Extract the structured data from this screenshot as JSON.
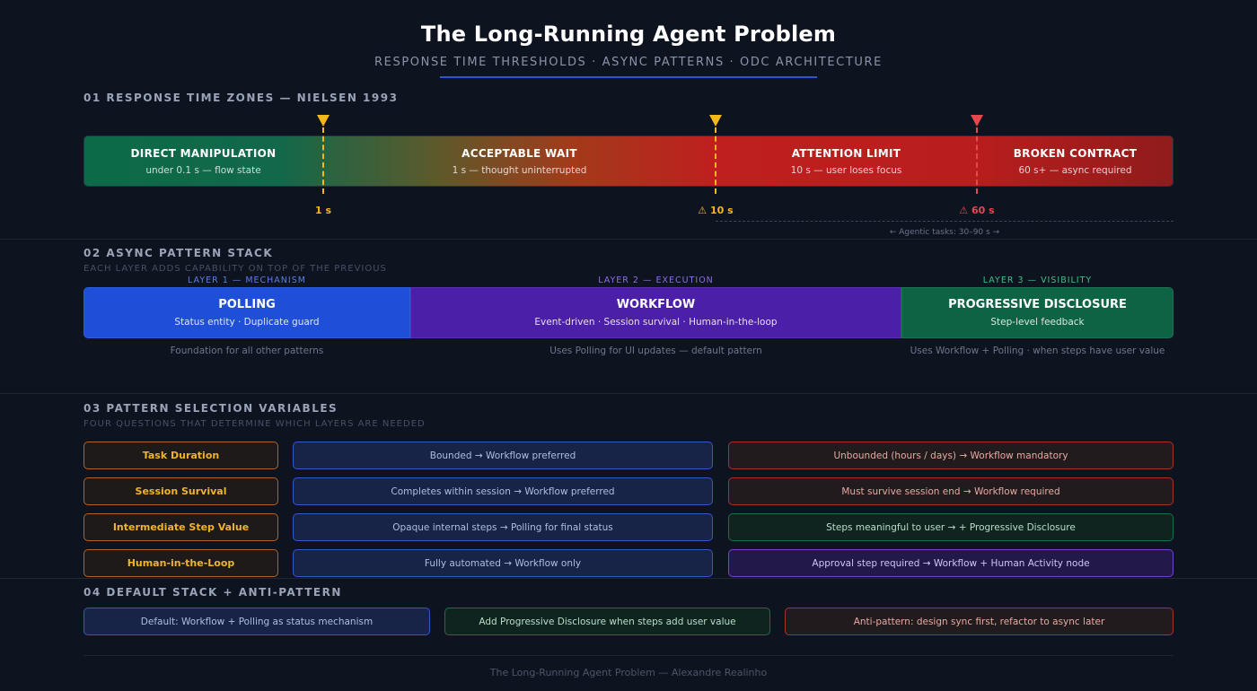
{
  "header": {
    "title": "The Long-Running Agent Problem",
    "subtitle": "RESPONSE TIME THRESHOLDS · ASYNC PATTERNS · ODC ARCHITECTURE"
  },
  "section1": {
    "title": "01 RESPONSE TIME ZONES — NIELSEN 1993",
    "zones": [
      {
        "title": "DIRECT MANIPULATION",
        "sub": "under 0.1 s — flow state"
      },
      {
        "title": "ACCEPTABLE WAIT",
        "sub": "1 s — thought uninterrupted"
      },
      {
        "title": "ATTENTION LIMIT",
        "sub": "10 s — user loses focus"
      },
      {
        "title": "BROKEN CONTRACT",
        "sub": "60 s+ — async required"
      }
    ],
    "markers": [
      {
        "label": "1 s",
        "color": "#f5b819"
      },
      {
        "label": "⚠ 10 s",
        "color": "#f5b819"
      },
      {
        "label": "⚠ 60 s",
        "color": "#e5484d"
      }
    ],
    "agentic_note": "← Agentic tasks: 30–90 s →"
  },
  "section2": {
    "title": "02 ASYNC PATTERN STACK",
    "subtitle": "EACH LAYER ADDS CAPABILITY ON TOP OF THE PREVIOUS",
    "layers": [
      {
        "label": "LAYER 1 — MECHANISM",
        "title": "POLLING",
        "sub": "Status entity · Duplicate guard",
        "note": "Foundation for all other patterns",
        "color": "#1f4fd8",
        "label_color": "#5b7fe0"
      },
      {
        "label": "LAYER 2 — EXECUTION",
        "title": "WORKFLOW",
        "sub": "Event-driven · Session survival · Human-in-the-loop",
        "note": "Uses Polling for UI updates — default pattern",
        "color": "#4c1fa8",
        "label_color": "#8d6fe0"
      },
      {
        "label": "LAYER 3 — VISIBILITY",
        "title": "PROGRESSIVE DISCLOSURE",
        "sub": "Step-level feedback",
        "note": "Uses Workflow + Polling · when steps have user value",
        "color": "#0c6445",
        "label_color": "#3fbf84"
      }
    ]
  },
  "section3": {
    "title": "03 PATTERN SELECTION VARIABLES",
    "subtitle": "FOUR QUESTIONS THAT DETERMINE WHICH LAYERS ARE NEEDED",
    "rows": [
      {
        "label": "Task Duration",
        "mid": "Bounded → Workflow preferred",
        "right": "Unbounded (hours / days) → Workflow mandatory",
        "right_style": "red"
      },
      {
        "label": "Session Survival",
        "mid": "Completes within session → Workflow preferred",
        "right": "Must survive session end → Workflow required",
        "right_style": "red"
      },
      {
        "label": "Intermediate Step Value",
        "mid": "Opaque internal steps → Polling for final status",
        "right": "Steps meaningful to user → + Progressive Disclosure",
        "right_style": "green"
      },
      {
        "label": "Human-in-the-Loop",
        "mid": "Fully automated → Workflow only",
        "right": "Approval step required → Workflow + Human Activity node",
        "right_style": "purple"
      }
    ]
  },
  "section4": {
    "title": "04 DEFAULT STACK + ANTI-PATTERN",
    "boxes": [
      {
        "text": "Default: Workflow + Polling as status mechanism"
      },
      {
        "text": "Add Progressive Disclosure when steps add user value"
      },
      {
        "text": "Anti-pattern: design sync first, refactor to async later"
      }
    ]
  },
  "footer": "The Long-Running Agent Problem — Alexandre Realinho"
}
